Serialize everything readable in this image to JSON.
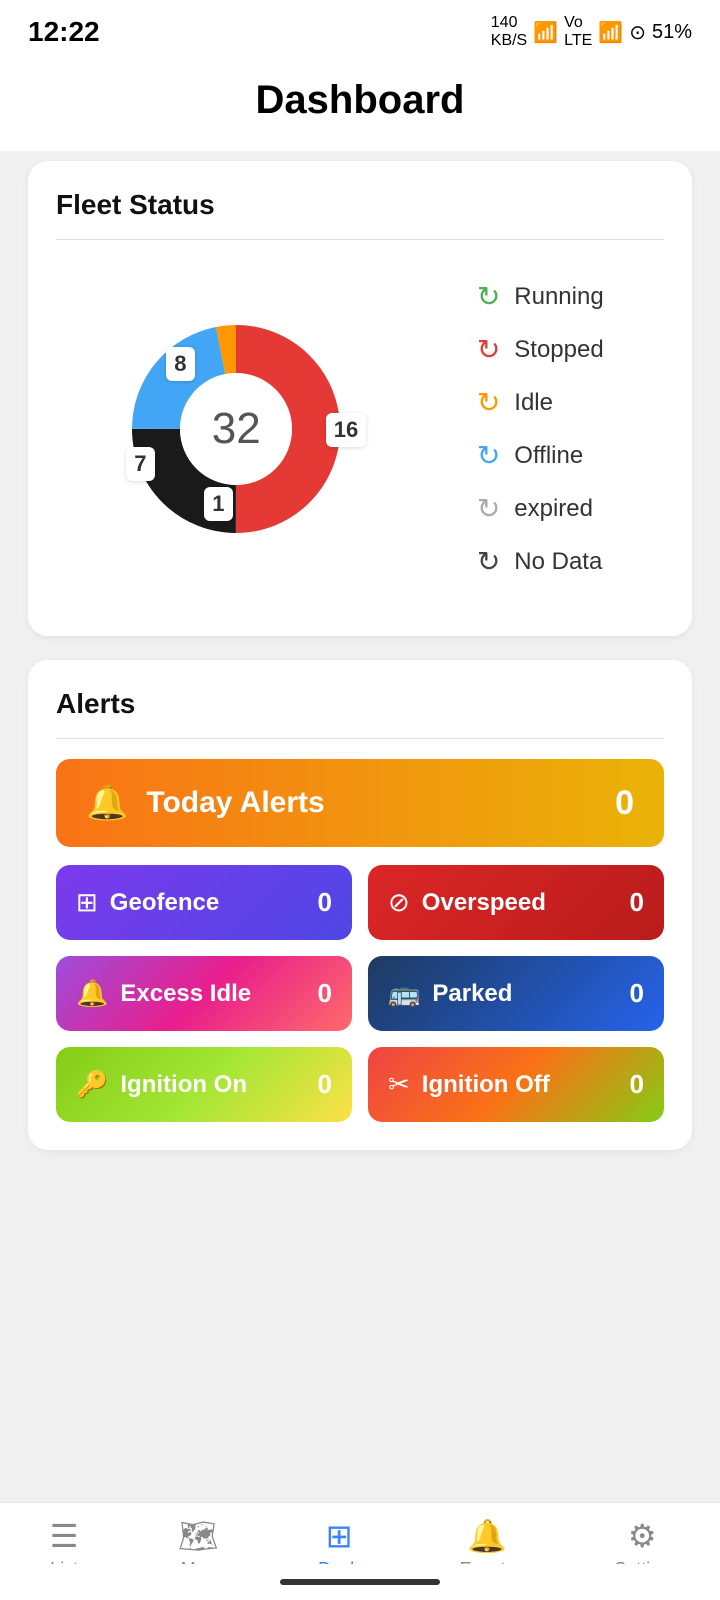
{
  "statusBar": {
    "time": "12:22",
    "network": "140 KB/S",
    "battery": "51%"
  },
  "header": {
    "title": "Dashboard"
  },
  "fleetStatus": {
    "title": "Fleet Status",
    "total": "32",
    "segments": {
      "running": {
        "value": 16,
        "color": "#e53935",
        "label": "16"
      },
      "stopped": {
        "value": 8,
        "color": "#1a1a1a",
        "label": "8"
      },
      "idle": {
        "value": 1,
        "color": "#ff9800",
        "label": "1"
      },
      "offline": {
        "value": 7,
        "color": "#42a5f5",
        "label": "7"
      }
    },
    "legend": [
      {
        "name": "Running",
        "color": "#4caf50"
      },
      {
        "name": "Stopped",
        "color": "#e53935"
      },
      {
        "name": "Idle",
        "color": "#ff9800"
      },
      {
        "name": "Offline",
        "color": "#42a5f5"
      },
      {
        "name": "expired",
        "color": "#aaa"
      },
      {
        "name": "No Data",
        "color": "#444"
      }
    ]
  },
  "alerts": {
    "title": "Alerts",
    "todayAlerts": {
      "label": "Today Alerts",
      "count": "0"
    },
    "items": [
      {
        "id": "geofence",
        "label": "Geofence",
        "count": "0",
        "icon": "⊞"
      },
      {
        "id": "overspeed",
        "label": "Overspeed",
        "count": "0",
        "icon": "⊘"
      },
      {
        "id": "excessidle",
        "label": "Excess Idle",
        "count": "0",
        "icon": "🔔"
      },
      {
        "id": "parked",
        "label": "Parked",
        "count": "0",
        "icon": "🚌"
      },
      {
        "id": "ignitionon",
        "label": "Ignition On",
        "count": "0",
        "icon": "🔑"
      },
      {
        "id": "ignitionoff",
        "label": "Ignition Off",
        "count": "0",
        "icon": "✂"
      }
    ]
  },
  "bottomNav": [
    {
      "id": "list",
      "label": "List",
      "icon": "≡",
      "active": false
    },
    {
      "id": "map",
      "label": "Map",
      "icon": "◻",
      "active": false
    },
    {
      "id": "dash",
      "label": "Dash",
      "icon": "⊞",
      "active": true
    },
    {
      "id": "events",
      "label": "Events",
      "icon": "🔔",
      "active": false
    },
    {
      "id": "setting",
      "label": "Setting",
      "icon": "⚙",
      "active": false
    }
  ]
}
